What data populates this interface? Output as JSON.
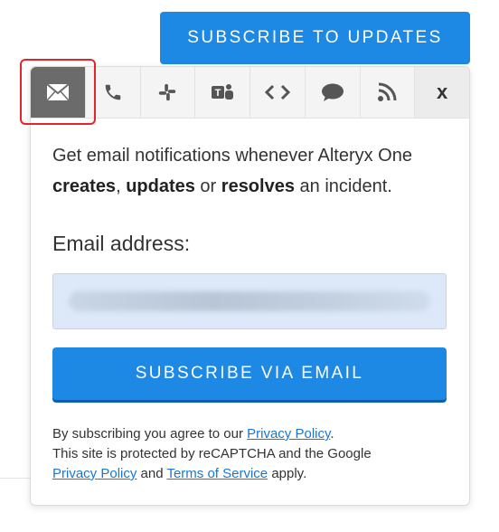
{
  "header": {
    "subscribe_button": "SUBSCRIBE TO UPDATES"
  },
  "tabs": [
    {
      "id": "email",
      "icon": "envelope-icon",
      "active": true
    },
    {
      "id": "phone",
      "icon": "phone-icon"
    },
    {
      "id": "slack",
      "icon": "slack-icon"
    },
    {
      "id": "teams",
      "icon": "teams-icon"
    },
    {
      "id": "webhook",
      "icon": "code-icon"
    },
    {
      "id": "chat",
      "icon": "chat-bubble-icon"
    },
    {
      "id": "rss",
      "icon": "rss-icon"
    },
    {
      "id": "close",
      "label": "x"
    }
  ],
  "email_panel": {
    "desc_part1": "Get email notifications whenever Alteryx One ",
    "desc_creates": "creates",
    "desc_comma": ", ",
    "desc_updates": "updates",
    "desc_or": " or ",
    "desc_resolves": "resolves",
    "desc_end": " an incident.",
    "email_label": "Email address:",
    "email_value": "",
    "submit_label": "SUBSCRIBE VIA EMAIL"
  },
  "legal": {
    "line1_prefix": "By subscribing you agree to our ",
    "privacy_link": "Privacy Policy",
    "line1_suffix": ".",
    "line2": "This site is protected by reCAPTCHA and the Google",
    "google_privacy_link": "Privacy Policy",
    "and": " and ",
    "terms_link": "Terms of Service",
    "line3_suffix": " apply."
  },
  "colors": {
    "accent": "#1e88e5",
    "active_tab": "#6b6b6b",
    "highlight": "#e5232b",
    "link": "#1976d2"
  }
}
